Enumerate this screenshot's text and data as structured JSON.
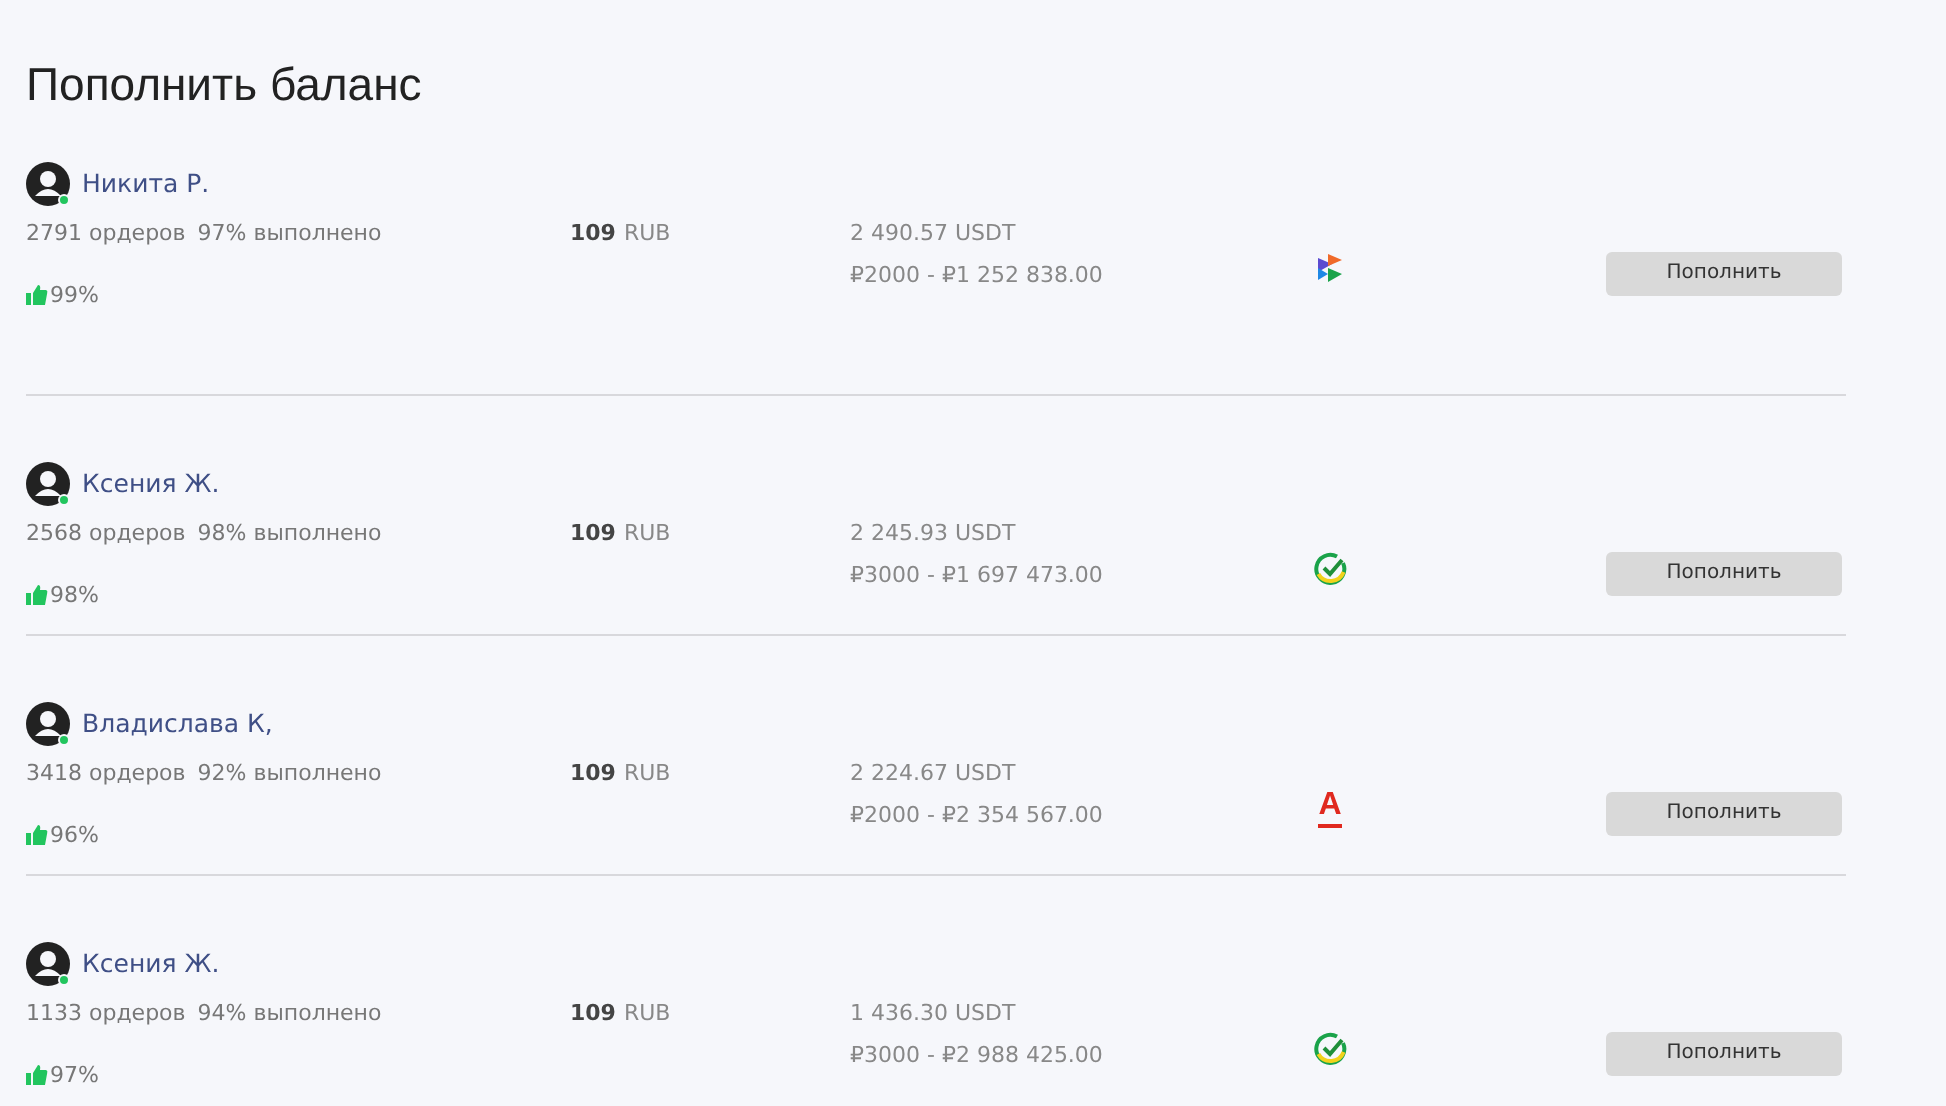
{
  "title": "Пополнить баланс",
  "offers": [
    {
      "name": "Никита Р.",
      "online": true,
      "orders": "2791 ордеров",
      "completion": "97% выполнено",
      "price": "109",
      "currency": "RUB",
      "available": "2 490.57 USDT",
      "limits": "₽2000 - ₽1 252 838.00",
      "rating": "99%",
      "bank": {
        "kind": "multi"
      },
      "button": "Пополнить"
    },
    {
      "name": "Ксения Ж.",
      "online": true,
      "orders": "2568 ордеров",
      "completion": "98% выполнено",
      "price": "109",
      "currency": "RUB",
      "available": "2 245.93 USDT",
      "limits": "₽3000 - ₽1 697 473.00",
      "rating": "98%",
      "bank": {
        "kind": "check"
      },
      "button": "Пополнить"
    },
    {
      "name": "Владислава К,",
      "online": true,
      "orders": "3418 ордеров",
      "completion": "92% выполнено",
      "price": "109",
      "currency": "RUB",
      "available": "2 224.67 USDT",
      "limits": "₽2000 - ₽2 354 567.00",
      "rating": "96%",
      "bank": {
        "kind": "letter",
        "text": "А"
      },
      "button": "Пополнить"
    },
    {
      "name": "Ксения Ж.",
      "online": true,
      "orders": "1133 ордеров",
      "completion": "94% выполнено",
      "price": "109",
      "currency": "RUB",
      "available": "1 436.30 USDT",
      "limits": "₽3000 - ₽2 988 425.00",
      "rating": "97%",
      "bank": {
        "kind": "check"
      },
      "button": "Пополнить"
    }
  ]
}
